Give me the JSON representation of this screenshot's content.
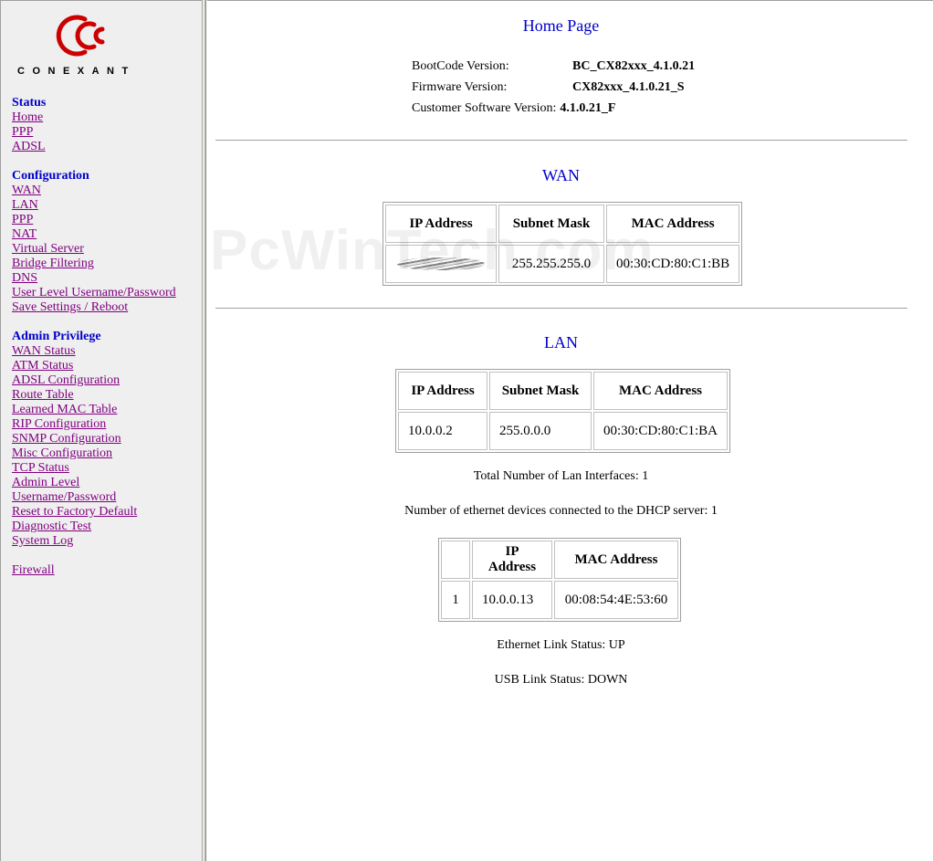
{
  "brand": {
    "logo_text": "CONEXANT"
  },
  "sidebar": {
    "status": {
      "title": "Status",
      "items": [
        "Home",
        "PPP",
        "ADSL"
      ]
    },
    "configuration": {
      "title": "Configuration",
      "items": [
        "WAN",
        "LAN",
        "PPP",
        "NAT",
        "Virtual Server",
        "Bridge Filtering",
        "DNS",
        "User Level Username/Password",
        "Save Settings / Reboot"
      ]
    },
    "admin": {
      "title": "Admin Privilege",
      "items": [
        "WAN Status",
        "ATM Status",
        "ADSL Configuration",
        "Route Table",
        "Learned MAC Table",
        "RIP Configuration",
        "SNMP Configuration",
        "Misc Configuration",
        "TCP Status",
        "Admin Level",
        "Username/Password",
        "Reset to Factory Default",
        "Diagnostic Test",
        "System Log"
      ]
    },
    "firewall": "Firewall"
  },
  "main": {
    "title": "Home Page",
    "versions": [
      {
        "label": "BootCode Version:",
        "value": "BC_CX82xxx_4.1.0.21"
      },
      {
        "label": "Firmware Version:",
        "value": "CX82xxx_4.1.0.21_S"
      },
      {
        "label": "Customer Software Version:",
        "value": "4.1.0.21_F"
      }
    ],
    "watermark": "PcWinTech.com",
    "wan": {
      "title": "WAN",
      "headers": [
        "IP Address",
        "Subnet Mask",
        "MAC Address"
      ],
      "row": {
        "ip": "",
        "mask": "255.255.255.0",
        "mac": "00:30:CD:80:C1:BB"
      }
    },
    "lan": {
      "title": "LAN",
      "headers": [
        "IP Address",
        "Subnet Mask",
        "MAC Address"
      ],
      "row": {
        "ip": "10.0.0.2",
        "mask": "255.0.0.0",
        "mac": "00:30:CD:80:C1:BA"
      }
    },
    "lan_interfaces": "Total Number of Lan Interfaces: 1",
    "dhcp_devices": "Number of ethernet devices connected to the DHCP server: 1",
    "dhcp": {
      "headers": [
        "",
        "IP Address",
        "MAC Address"
      ],
      "row": {
        "index": "1",
        "ip": "10.0.0.13",
        "mac": "00:08:54:4E:53:60"
      }
    },
    "ethernet_status": "Ethernet Link Status: UP",
    "usb_status": "USB Link Status: DOWN"
  },
  "colors": {
    "logo_red": "#cc0000",
    "heading_blue": "#0000cc",
    "link_visited": "#800080",
    "sidebar_bg": "#efefef"
  }
}
